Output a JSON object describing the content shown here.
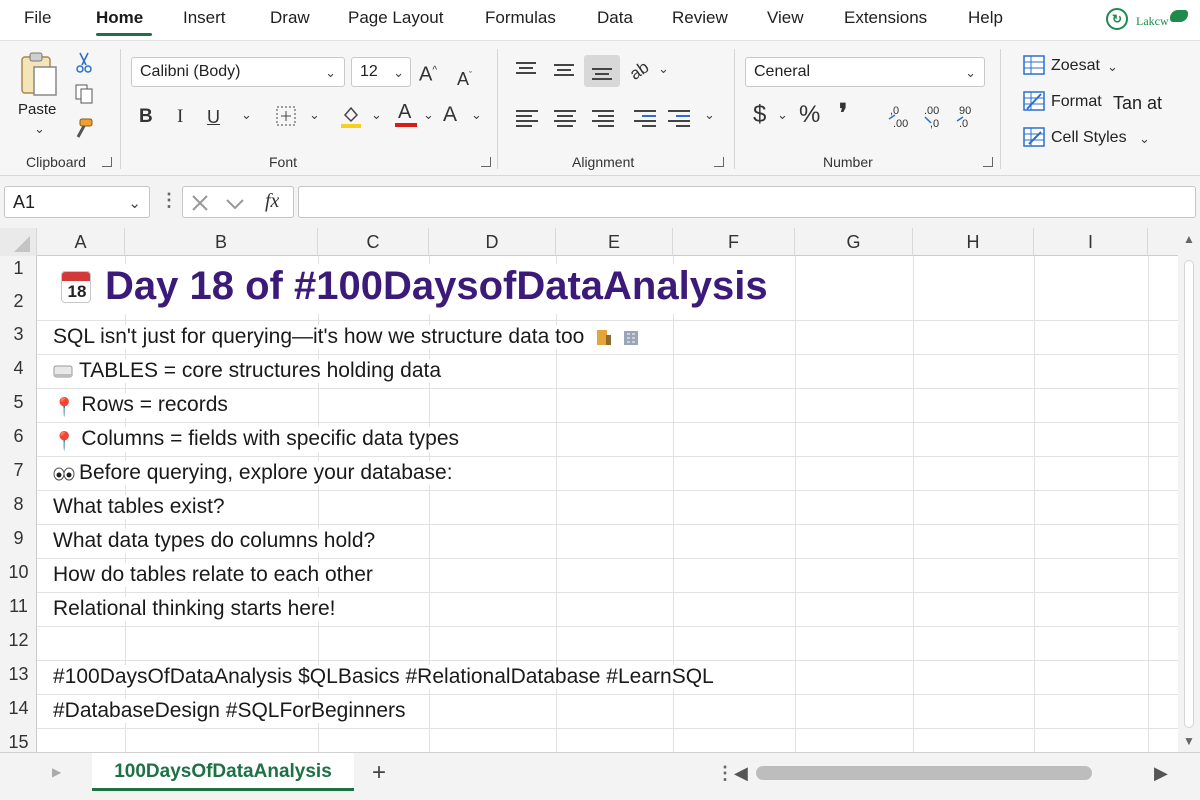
{
  "menu": {
    "items": [
      "File",
      "Home",
      "Insert",
      "Draw",
      "Page Layout",
      "Formulas",
      "Data",
      "Review",
      "View",
      "Extensions",
      "Help"
    ],
    "active": "Home",
    "logo_text": "Lakcw"
  },
  "ribbon": {
    "clipboard": {
      "paste_label": "Paste",
      "group_label": "Clipboard"
    },
    "font": {
      "font_name": "Calibni (Body)",
      "font_size": "12",
      "bold": "B",
      "italic": "I",
      "underline": "U",
      "group_label": "Font"
    },
    "alignment": {
      "group_label": "Alignment"
    },
    "number": {
      "format": "Ceneral",
      "currency": "$",
      "percent": "%",
      "comma": "❜",
      "group_label": "Number"
    },
    "styles": {
      "conditional_label": "Zoesat",
      "format_label": "Format",
      "format_extra": "Tan at",
      "cell_styles_label": "Cell Styles"
    }
  },
  "formula_bar": {
    "name_box": "A1",
    "fx": "fx",
    "value": ""
  },
  "columns": [
    "A",
    "B",
    "C",
    "D",
    "E",
    "F",
    "G",
    "H",
    "I"
  ],
  "rows": [
    "1",
    "2",
    "3",
    "4",
    "5",
    "6",
    "7",
    "8",
    "9",
    "10",
    "11",
    "12",
    "13",
    "14",
    "15"
  ],
  "sheet": {
    "title_icon_number": "18",
    "title": "Day 18 of #100DaysofDataAnalysis",
    "lines": {
      "r3": "SQL isn't just for querying—it's how we structure data too",
      "r4": "TABLES = core structures holding data",
      "r5": "Rows = records",
      "r6": "Columns = fields with specific data types",
      "r7": "Before querying, explore your database:",
      "r8": "What tables exist?",
      "r9": "What data types do columns hold?",
      "r10": "How do tables relate to each other",
      "r11": "Relational thinking starts here!",
      "r13": "#100DaysOfDataAnalysis $QLBasics #RelationalDatabase #LearnSQL",
      "r14": "#DatabaseDesign #SQLForBeginners"
    }
  },
  "tabs": {
    "active_sheet": "100DaysOfDataAnalysis",
    "add": "+"
  },
  "colors": {
    "accent": "#1e7145",
    "title": "#3b1a7a"
  }
}
